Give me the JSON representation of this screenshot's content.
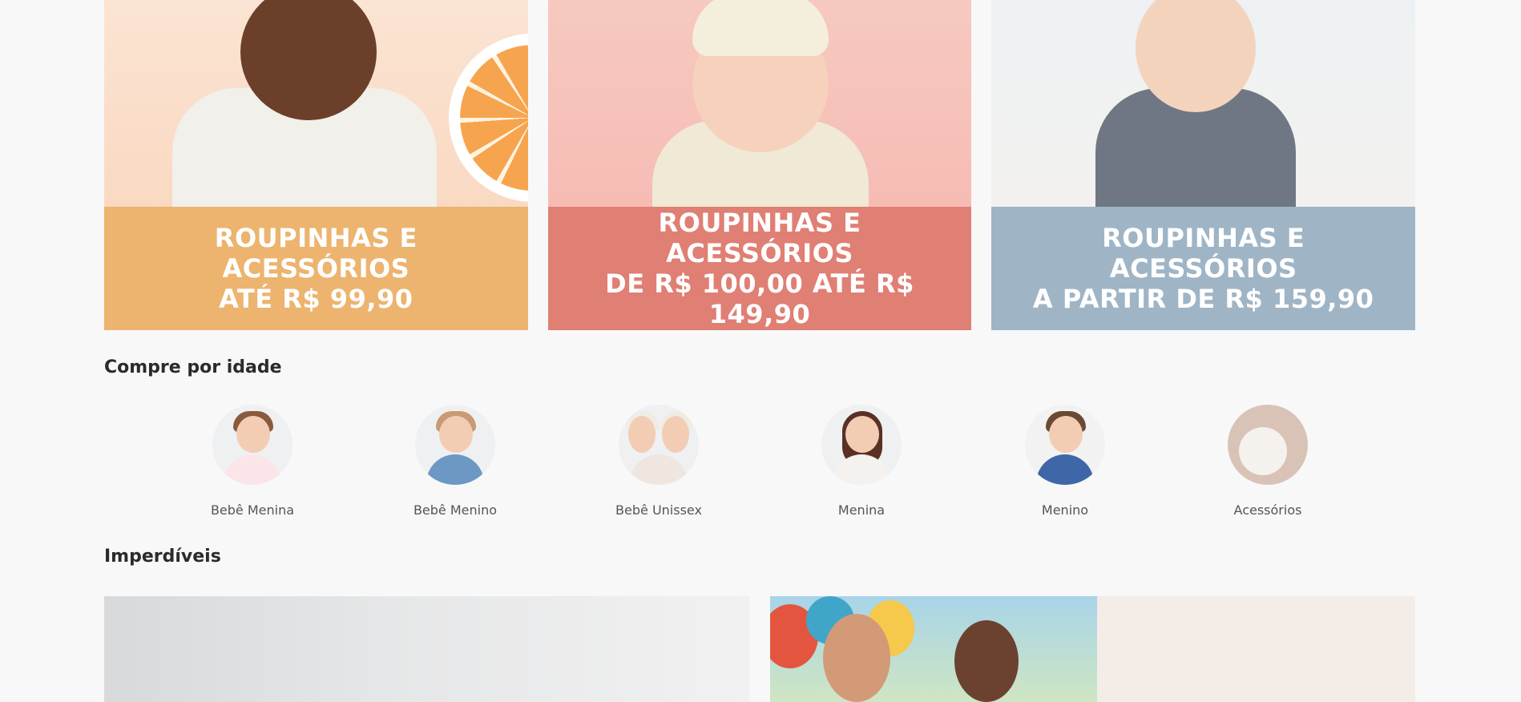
{
  "promo_cards": [
    {
      "line1": "ROUPINHAS E ACESSÓRIOS",
      "line2": "ATÉ R$ 99,90",
      "color": "#ecb46f"
    },
    {
      "line1": "ROUPINHAS E ACESSÓRIOS",
      "line2": "DE R$ 100,00 ATÉ R$ 149,90",
      "color": "#e07f74"
    },
    {
      "line1": "ROUPINHAS E ACESSÓRIOS",
      "line2": "A PARTIR DE R$ 159,90",
      "color": "#9fb5c6"
    }
  ],
  "shop_by_age": {
    "title": "Compre por idade",
    "items": [
      {
        "label": "Bebê Menina",
        "icon": "baby-girl-photo"
      },
      {
        "label": "Bebê Menino",
        "icon": "baby-boy-photo"
      },
      {
        "label": "Bebê Unissex",
        "icon": "baby-unisex-photo"
      },
      {
        "label": "Menina",
        "icon": "girl-photo"
      },
      {
        "label": "Menino",
        "icon": "boy-photo"
      },
      {
        "label": "Acessórios",
        "icon": "accessories-photo"
      }
    ]
  },
  "must_haves": {
    "title": "Imperdíveis"
  },
  "colors": {
    "background": "#f8f8f8",
    "orange": "#ecb46f",
    "coral": "#e07f74",
    "blue_grey": "#9fb5c6"
  }
}
